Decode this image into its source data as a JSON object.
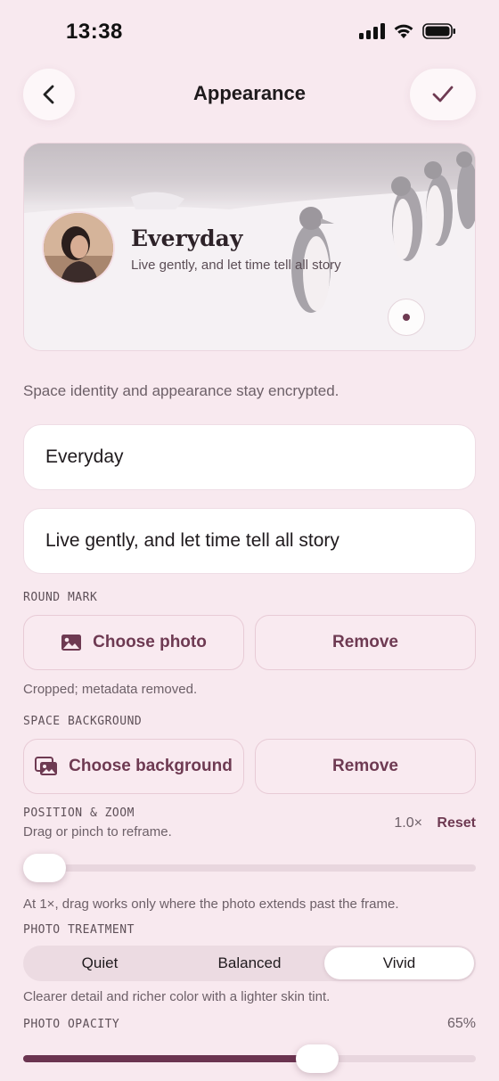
{
  "status": {
    "time": "13:38"
  },
  "nav": {
    "title": "Appearance"
  },
  "hero": {
    "title": "Everyday",
    "subtitle": "Live gently, and let time tell all story"
  },
  "encryption_note": "Space identity and appearance stay encrypted.",
  "fields": {
    "name_value": "Everyday",
    "tagline_value": "Live gently, and let time tell all story"
  },
  "round_mark": {
    "label": "ROUND MARK",
    "choose_label": "Choose photo",
    "remove_label": "Remove",
    "note": "Cropped; metadata removed."
  },
  "background": {
    "label": "SPACE BACKGROUND",
    "choose_label": "Choose background",
    "remove_label": "Remove"
  },
  "position_zoom": {
    "label": "POSITION & ZOOM",
    "hint": "Drag or pinch to reframe.",
    "zoom_value": "1.0×",
    "reset_label": "Reset",
    "zoom_level": 0.0,
    "note": "At 1×, drag works only where the photo extends past the frame."
  },
  "treatment": {
    "label": "PHOTO TREATMENT",
    "options": [
      "Quiet",
      "Balanced",
      "Vivid"
    ],
    "selected": "Vivid",
    "note": "Clearer detail and richer color with a lighter skin tint."
  },
  "opacity": {
    "label": "PHOTO OPACITY",
    "value_text": "65%",
    "value": 0.65
  },
  "colors": {
    "accent": "#6e3a52",
    "background": "#f8e9ef",
    "track": "#e8d6de"
  }
}
